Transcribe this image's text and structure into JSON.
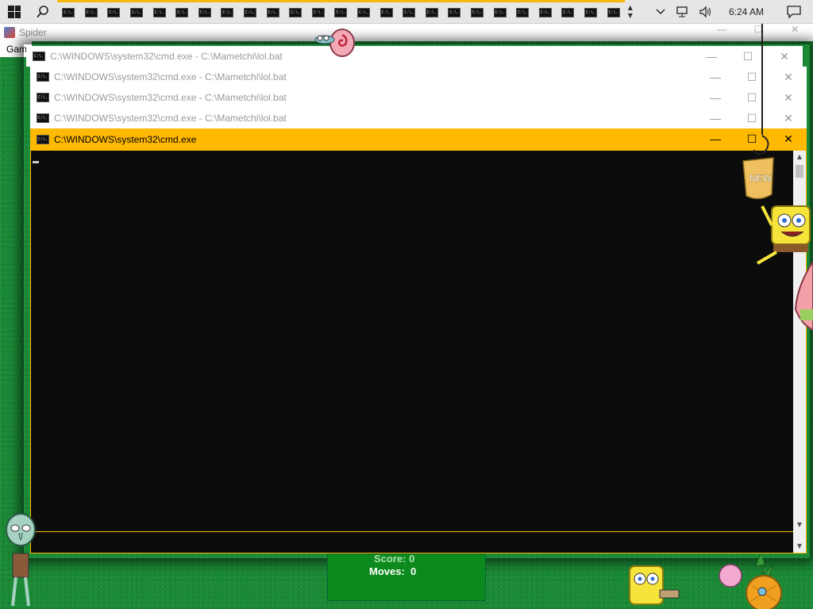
{
  "taskbar": {
    "start_icon": "windows-logo-icon",
    "search_icon": "search-icon",
    "app_buttons": [
      "C:\\.",
      "C:\\.",
      "C:\\.",
      "C:\\.",
      "C:\\.",
      "C:\\.",
      "C:\\.",
      "C:\\.",
      "C:\\.",
      "C:\\.",
      "C:\\.",
      "C:\\.",
      "C:\\.",
      "C:\\.",
      "C:\\.",
      "C:\\.",
      "C:\\.",
      "C:\\.",
      "C:\\.",
      "C:\\.",
      "C:\\.",
      "C:\\.",
      "C:\\.",
      "C:\\.",
      "C:\\."
    ],
    "app_icon_text": "C:\\.",
    "clock": "6:24 AM",
    "accent_color": "#f5b800"
  },
  "spider": {
    "title": "Spider",
    "menu": "Game",
    "moves_label": "Moves:",
    "moves_value": "0",
    "score_label": "Score:",
    "score_value": "0"
  },
  "windows": [
    {
      "title": "C:\\WINDOWS\\system32\\cmd.exe - C:\\Mametchi\\lol.bat"
    },
    {
      "title": "C:\\WINDOWS\\system32\\cmd.exe - C:\\Mametchi\\lol.bat"
    },
    {
      "title": "C:\\WINDOWS\\system32\\cmd.exe - C:\\Mametchi\\lol.bat"
    },
    {
      "title": "C:\\WINDOWS\\system32\\cmd.exe - C:\\Mametchi\\lol.bat"
    },
    {
      "title": "C:\\WINDOWS\\system32\\cmd.exe"
    }
  ],
  "window_controls": {
    "minimize": "—",
    "maximize": "☐",
    "close": "✕"
  },
  "colors": {
    "active_titlebar": "#ffb900",
    "console_bg": "#0c0c0c",
    "desktop_green": "#1a8a35"
  }
}
